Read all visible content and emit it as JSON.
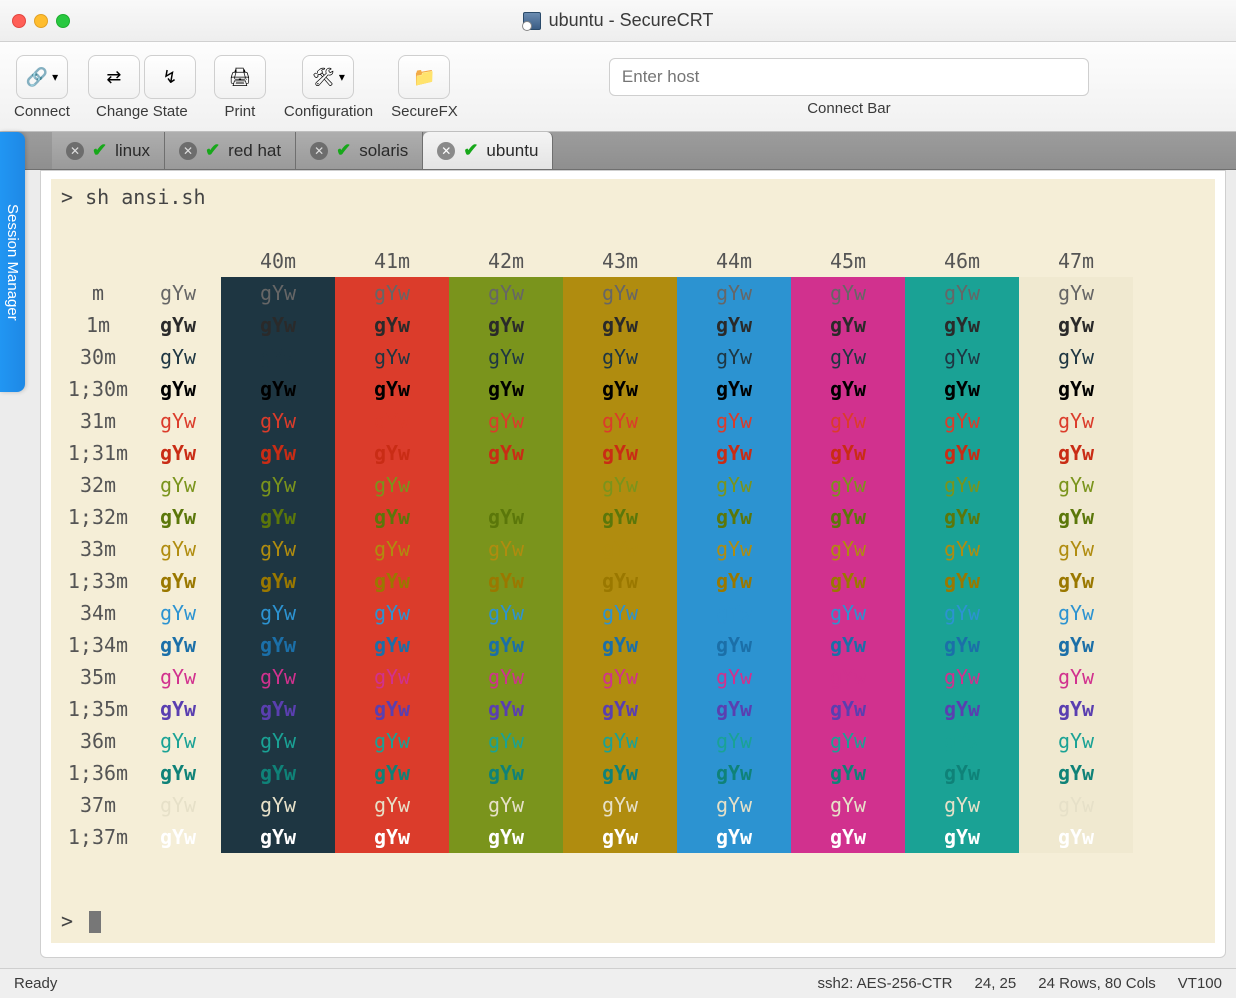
{
  "window": {
    "title": "ubuntu - SecureCRT"
  },
  "toolbar": {
    "connect": "Connect",
    "change_state": "Change State",
    "print": "Print",
    "configuration": "Configuration",
    "securefx": "SecureFX",
    "connect_bar_label": "Connect Bar",
    "host_placeholder": "Enter host"
  },
  "session_manager_label": "Session Manager",
  "tabs": [
    {
      "label": "linux",
      "active": false
    },
    {
      "label": "red hat",
      "active": false
    },
    {
      "label": "solaris",
      "active": false
    },
    {
      "label": "ubuntu",
      "active": true
    }
  ],
  "terminal": {
    "command": "sh ansi.sh",
    "prompt": ">",
    "sample_text": "gYw",
    "bg_headers": [
      "40m",
      "41m",
      "42m",
      "43m",
      "44m",
      "45m",
      "46m",
      "47m"
    ],
    "rows": [
      {
        "label": "m",
        "fg": "fg-def"
      },
      {
        "label": "1m",
        "fg": "fg1-def"
      },
      {
        "label": "30m",
        "fg": "fg30"
      },
      {
        "label": "1;30m",
        "fg": "fg1-30"
      },
      {
        "label": "31m",
        "fg": "fg31"
      },
      {
        "label": "1;31m",
        "fg": "fg1-31"
      },
      {
        "label": "32m",
        "fg": "fg32"
      },
      {
        "label": "1;32m",
        "fg": "fg1-32"
      },
      {
        "label": "33m",
        "fg": "fg33"
      },
      {
        "label": "1;33m",
        "fg": "fg1-33"
      },
      {
        "label": "34m",
        "fg": "fg34"
      },
      {
        "label": "1;34m",
        "fg": "fg1-34"
      },
      {
        "label": "35m",
        "fg": "fg35"
      },
      {
        "label": "1;35m",
        "fg": "fg1-35"
      },
      {
        "label": "36m",
        "fg": "fg36"
      },
      {
        "label": "1;36m",
        "fg": "fg1-36"
      },
      {
        "label": "37m",
        "fg": "fg37"
      },
      {
        "label": "1;37m",
        "fg": "fg1-37"
      }
    ],
    "bg_classes": [
      "bg40",
      "bg41",
      "bg42",
      "bg43",
      "bg44",
      "bg45",
      "bg46",
      "bg47"
    ]
  },
  "status": {
    "ready": "Ready",
    "conn": "ssh2: AES-256-CTR",
    "pos": "24, 25",
    "size": "24 Rows, 80 Cols",
    "term": "VT100"
  }
}
